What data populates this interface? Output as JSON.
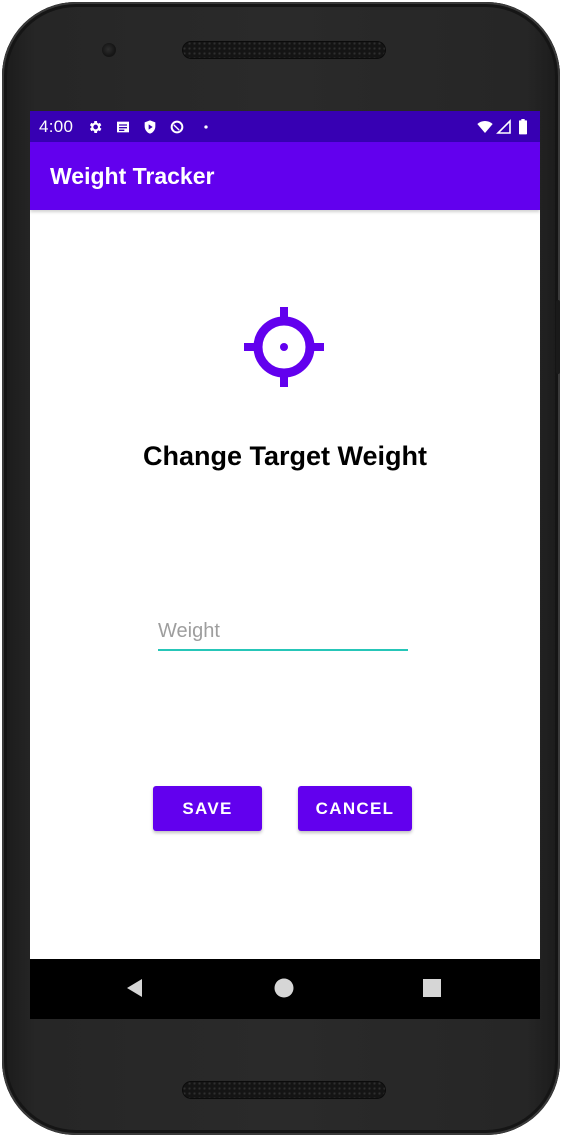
{
  "status_bar": {
    "time": "4:00",
    "left_icons": [
      "gear-icon",
      "notification-list-icon",
      "shield-icon",
      "data-saver-icon",
      "dot-icon"
    ],
    "right_icons": [
      "wifi-icon",
      "signal-icon",
      "battery-icon"
    ]
  },
  "app_bar": {
    "title": "Weight Tracker"
  },
  "main": {
    "icon": "target-icon",
    "heading": "Change Target Weight",
    "weight_input": {
      "placeholder": "Weight",
      "value": ""
    },
    "save_label": "SAVE",
    "cancel_label": "CANCEL"
  },
  "nav_bar": {
    "icons": [
      "back-icon",
      "home-icon",
      "recents-icon"
    ]
  },
  "colors": {
    "primary": "#6200ee",
    "primary_dark": "#3700b3",
    "accent_underline": "#26c6b8",
    "on_primary": "#ffffff"
  }
}
